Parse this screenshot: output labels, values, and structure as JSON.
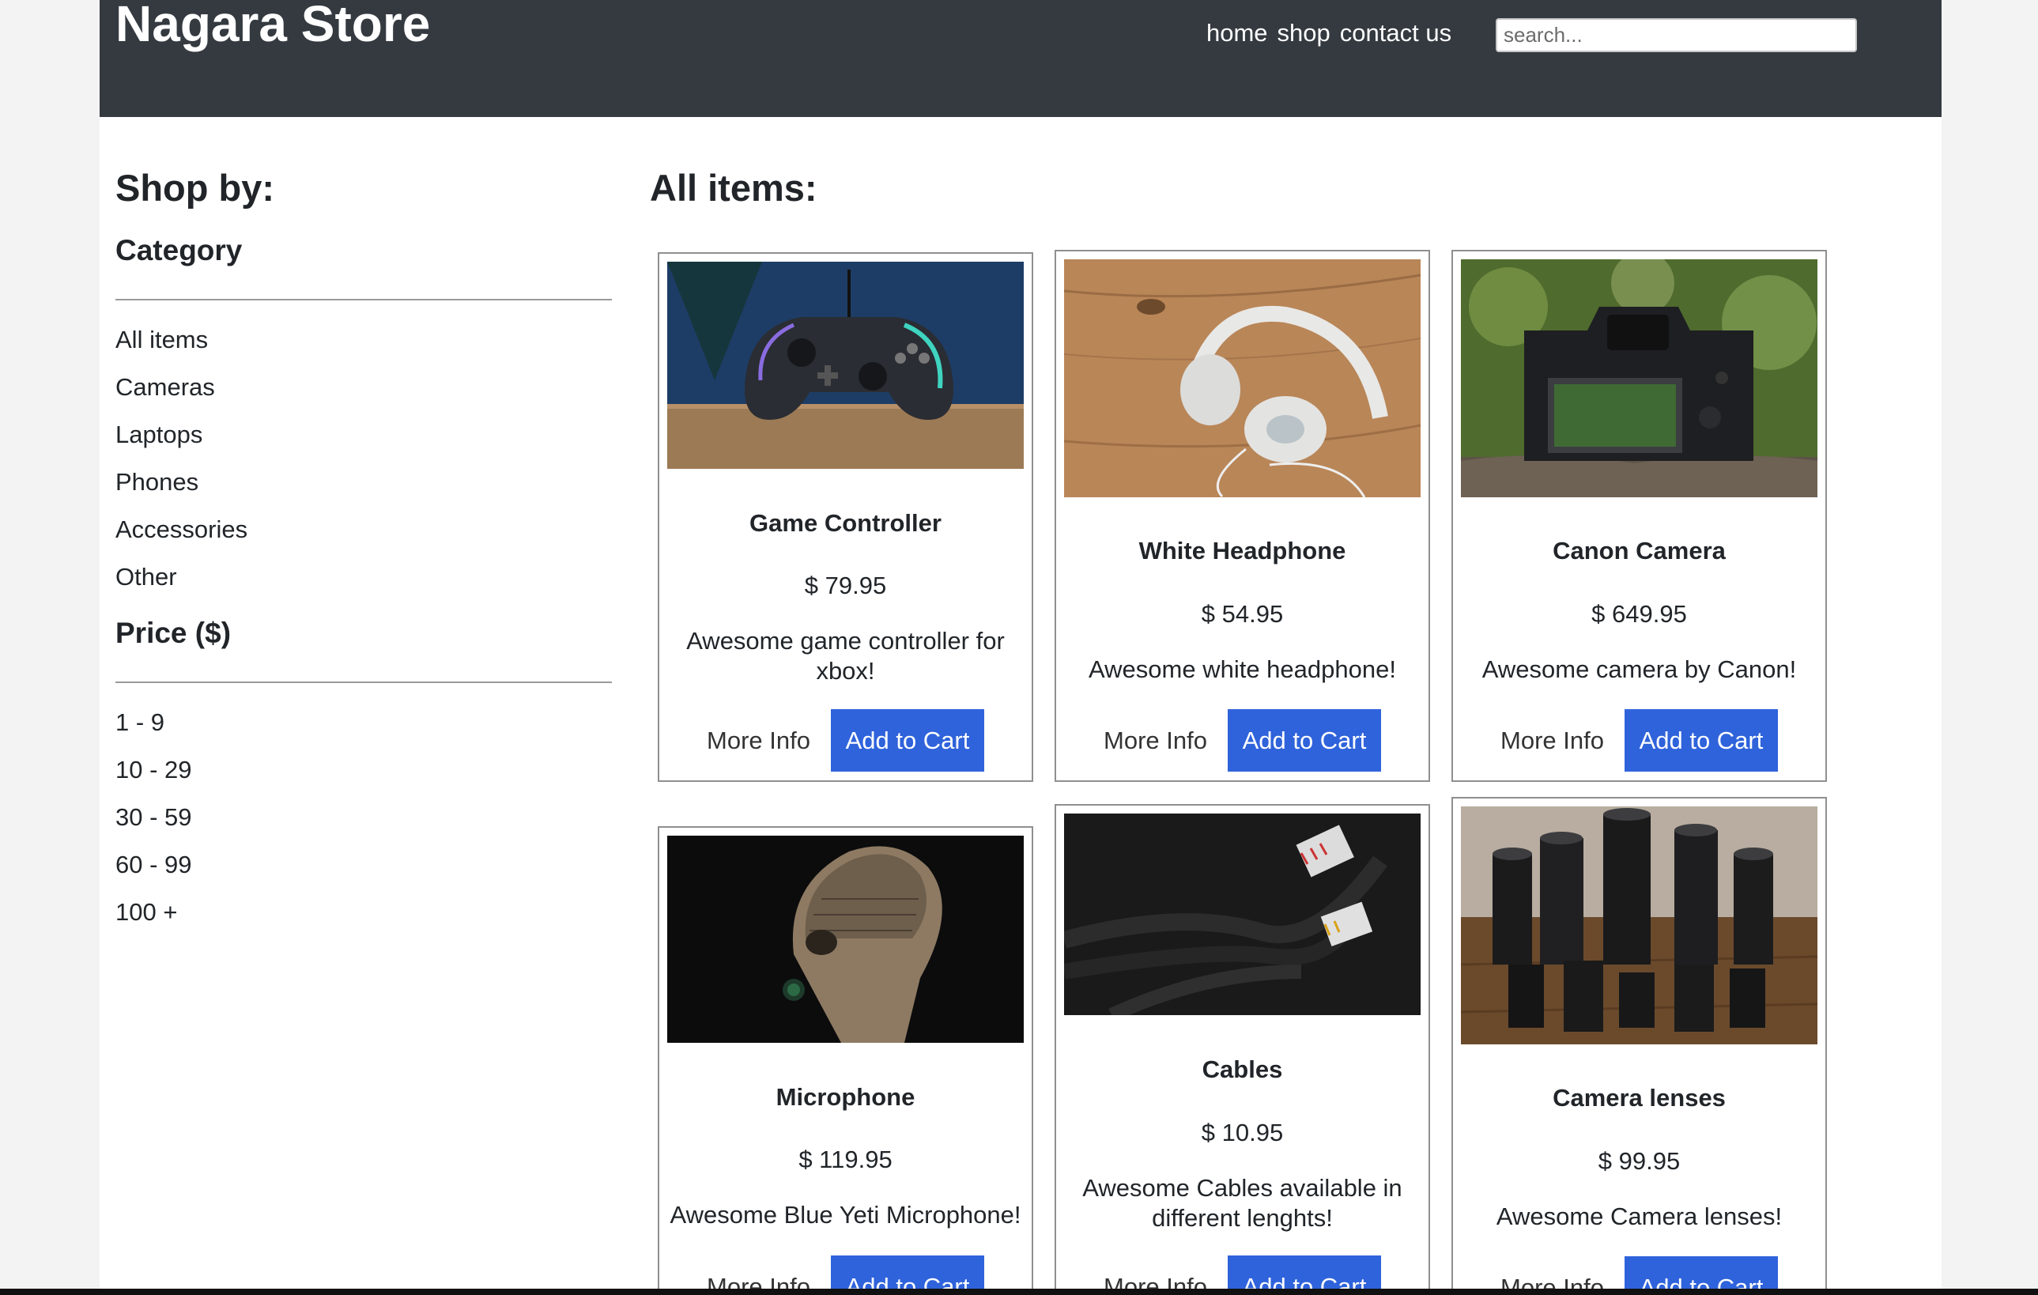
{
  "header": {
    "brand": "Nagara Store",
    "nav": [
      "home",
      "shop",
      "contact us"
    ],
    "search_placeholder": "search..."
  },
  "sidebar": {
    "title": "Shop by:",
    "category_heading": "Category",
    "categories": [
      "All items",
      "Cameras",
      "Laptops",
      "Phones",
      "Accessories",
      "Other"
    ],
    "price_heading": "Price ($)",
    "prices": [
      "1 - 9",
      "10 - 29",
      "30 - 59",
      "60 - 99",
      "100 +"
    ]
  },
  "main": {
    "title": "All items:",
    "more_label": "More Info",
    "cart_label": "Add to Cart",
    "products": [
      {
        "name": "Game Controller",
        "price": "$ 79.95",
        "desc": "Awesome game controller for xbox!"
      },
      {
        "name": "White Headphone",
        "price": "$ 54.95",
        "desc": "Awesome white headphone!"
      },
      {
        "name": "Canon Camera",
        "price": "$ 649.95",
        "desc": "Awesome camera by Canon!"
      },
      {
        "name": "Microphone",
        "price": "$ 119.95",
        "desc": "Awesome Blue Yeti Microphone!"
      },
      {
        "name": "Cables",
        "price": "$ 10.95",
        "desc": "Awesome Cables available in different lenghts!"
      },
      {
        "name": "Camera lenses",
        "price": "$ 99.95",
        "desc": "Awesome Camera lenses!"
      }
    ]
  }
}
